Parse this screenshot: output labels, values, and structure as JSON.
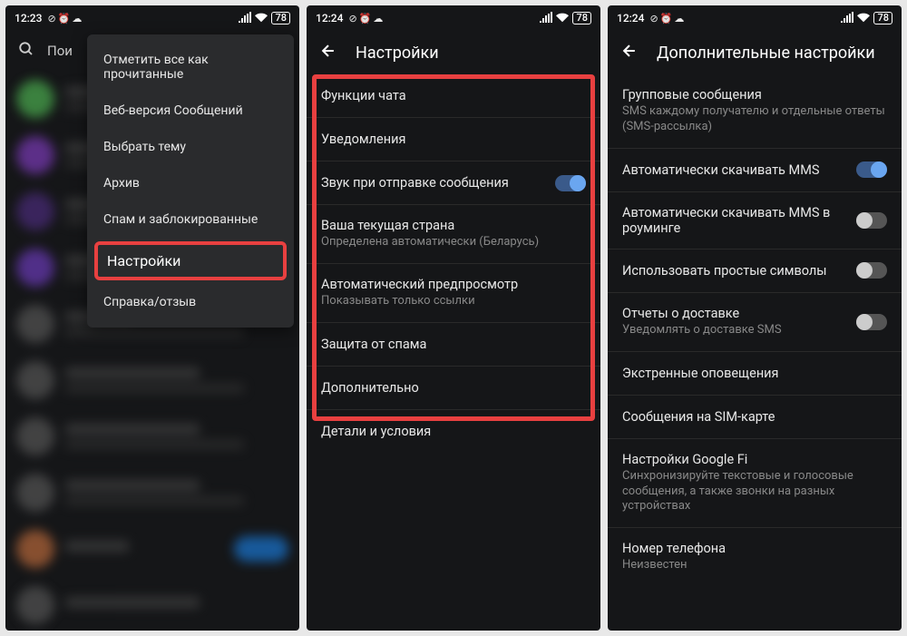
{
  "phone1": {
    "time": "12:23",
    "battery": "78",
    "search_placeholder": "Пои",
    "menu": {
      "mark_read": "Отметить все как прочитанные",
      "web": "Веб-версия Сообщений",
      "theme": "Выбрать тему",
      "archive": "Архив",
      "spam": "Спам и заблокированные",
      "settings": "Настройки",
      "help": "Справка/отзыв"
    }
  },
  "phone2": {
    "time": "12:24",
    "battery": "78",
    "title": "Настройки",
    "items": {
      "chat": "Функции чата",
      "notif": "Уведомления",
      "sound": "Звук при отправке сообщения",
      "country_t": "Ваша текущая страна",
      "country_s": "Определена автоматически (Беларусь)",
      "preview_t": "Автоматический предпросмотр",
      "preview_s": "Показывать только ссылки",
      "spam": "Защита от спама",
      "more": "Дополнительно",
      "details": "Детали и условия"
    }
  },
  "phone3": {
    "time": "12:24",
    "battery": "78",
    "title": "Дополнительные настройки",
    "items": {
      "group_t": "Групповые сообщения",
      "group_s": "SMS каждому получателю и отдельные ответы (SMS-рассылка)",
      "mms_auto": "Автоматически скачивать MMS",
      "mms_roam": "Автоматически скачивать MMS в роуминге",
      "simple": "Использовать простые символы",
      "delivery_t": "Отчеты о доставке",
      "delivery_s": "Уведомлять о доставке SMS",
      "emergency": "Экстренные оповещения",
      "sim": "Сообщения на SIM-карте",
      "fi_t": "Настройки Google Fi",
      "fi_s": "Синхронизируйте текстовые и голосовые сообщения, а также звонки на разных устройствах",
      "phone_t": "Номер телефона",
      "phone_s": "Неизвестен"
    }
  }
}
